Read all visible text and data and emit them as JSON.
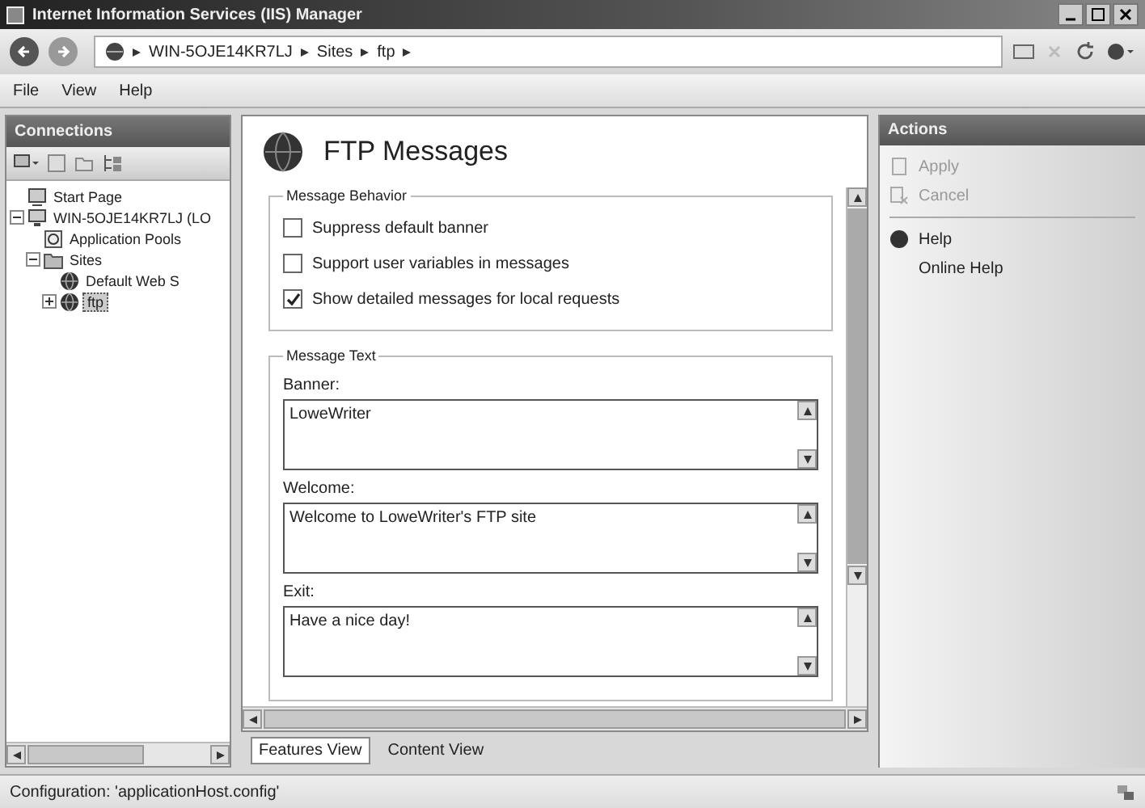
{
  "window": {
    "title": "Internet Information Services (IIS) Manager"
  },
  "address": {
    "breadcrumbs": [
      "WIN-5OJE14KR7LJ",
      "Sites",
      "ftp"
    ]
  },
  "menu": [
    "File",
    "View",
    "Help"
  ],
  "connections": {
    "title": "Connections",
    "tree": [
      {
        "label": "Start Page",
        "selected": false
      },
      {
        "label": "WIN-5OJE14KR7LJ (LO",
        "expanded": true,
        "selected": false,
        "children": [
          {
            "label": "Application Pools",
            "selected": false
          },
          {
            "label": "Sites",
            "expanded": true,
            "selected": false,
            "children": [
              {
                "label": "Default Web S",
                "selected": false
              },
              {
                "label": "ftp",
                "expanded": false,
                "selected": true
              }
            ]
          }
        ]
      }
    ]
  },
  "feature": {
    "title": "FTP Messages",
    "behavior": {
      "legend": "Message Behavior",
      "options": [
        {
          "label": "Suppress default banner",
          "checked": false
        },
        {
          "label": "Support user variables in messages",
          "checked": false
        },
        {
          "label": "Show detailed messages for local requests",
          "checked": true
        }
      ]
    },
    "text": {
      "legend": "Message Text",
      "fields": [
        {
          "label": "Banner:",
          "value": "LoweWriter"
        },
        {
          "label": "Welcome:",
          "value": "Welcome to LoweWriter's FTP site"
        },
        {
          "label": "Exit:",
          "value": "Have a nice day!"
        }
      ]
    }
  },
  "view_tabs": [
    {
      "label": "Features View",
      "selected": true
    },
    {
      "label": "Content View",
      "selected": false
    }
  ],
  "actions": {
    "title": "Actions",
    "items": [
      {
        "label": "Apply",
        "disabled": true
      },
      {
        "label": "Cancel",
        "disabled": true
      },
      {
        "label": "Help",
        "disabled": false
      },
      {
        "label": "Online Help",
        "disabled": false
      }
    ]
  },
  "status_bar": "Configuration: 'applicationHost.config'"
}
